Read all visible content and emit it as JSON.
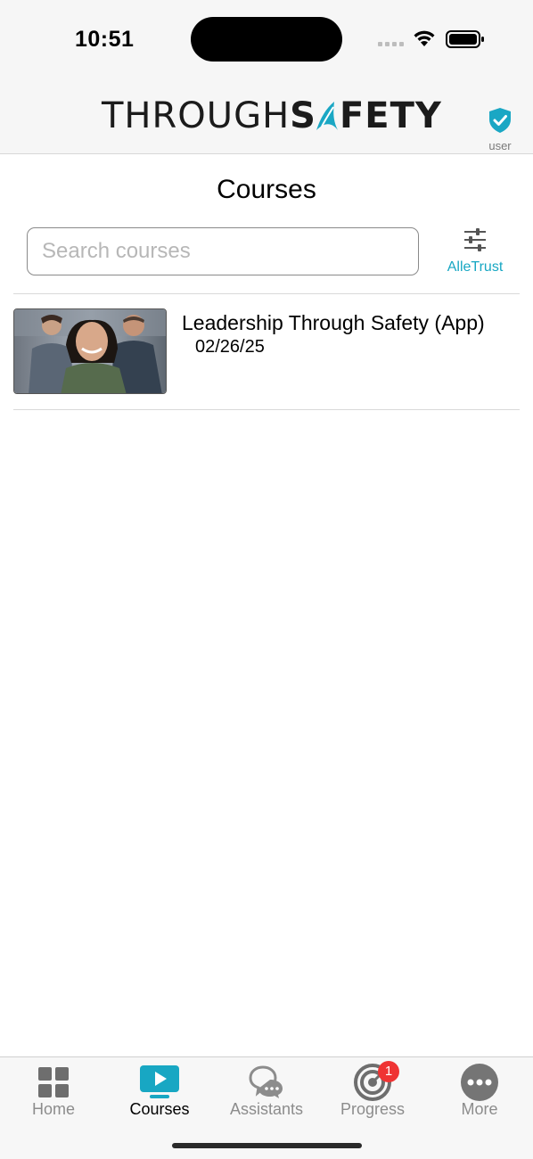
{
  "status_bar": {
    "time": "10:51"
  },
  "header": {
    "logo_part1": "THROUGH",
    "logo_part2": "S",
    "logo_part3": "FETY",
    "user_label": "user",
    "user_icon": "verified-shield-icon"
  },
  "page": {
    "title": "Courses"
  },
  "search": {
    "placeholder": "Search courses",
    "value": ""
  },
  "filter": {
    "label": "AlleTrust",
    "icon": "sliders-icon"
  },
  "courses": [
    {
      "title": "Leadership Through Safety (App)",
      "date": "02/26/25",
      "image": "team-photo-thumbnail"
    }
  ],
  "tab_bar": {
    "tabs": [
      {
        "label": "Home",
        "icon": "grid-icon",
        "active": false
      },
      {
        "label": "Courses",
        "icon": "play-screen-icon",
        "active": true
      },
      {
        "label": "Assistants",
        "icon": "chat-bubbles-icon",
        "active": false
      },
      {
        "label": "Progress",
        "icon": "target-icon",
        "active": false,
        "badge": "1"
      },
      {
        "label": "More",
        "icon": "more-dots-icon",
        "active": false
      }
    ]
  },
  "colors": {
    "accent": "#18a7c3",
    "badge": "#ef3333",
    "inactive_tab": "#8c8c8c"
  }
}
